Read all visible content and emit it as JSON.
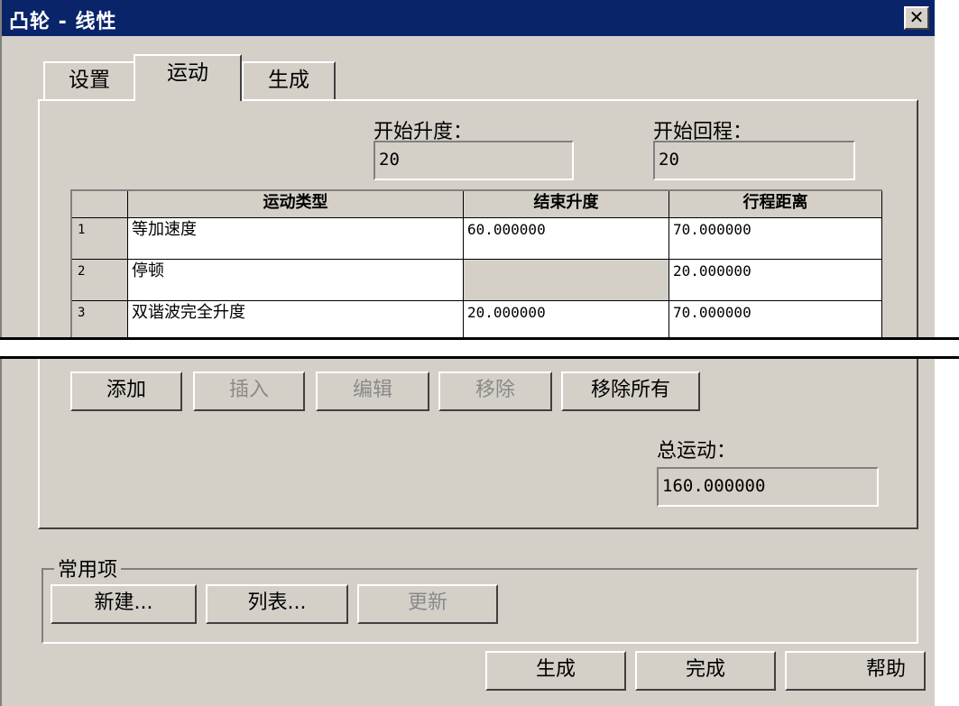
{
  "window": {
    "title": "凸轮 - 线性",
    "close_glyph": "✕"
  },
  "tabs": [
    {
      "label": "设置"
    },
    {
      "label": "运动"
    },
    {
      "label": "生成"
    }
  ],
  "motion": {
    "start_lift_label": "开始升度：",
    "start_lift_value": "20",
    "start_return_label": "开始回程：",
    "start_return_value": "20",
    "table": {
      "columns": [
        "运动类型",
        "结束升度",
        "行程距离"
      ],
      "rows": [
        {
          "num": "1",
          "type": "等加速度",
          "end_lift": "60.000000",
          "distance": "70.000000"
        },
        {
          "num": "2",
          "type": "停顿",
          "end_lift": "",
          "distance": "20.000000"
        },
        {
          "num": "3",
          "type": "双谐波完全升度",
          "end_lift": "20.000000",
          "distance": "70.000000"
        }
      ]
    },
    "buttons": {
      "add": "添加",
      "insert": "插入",
      "edit": "编辑",
      "remove": "移除",
      "remove_all": "移除所有"
    },
    "total_label": "总运动：",
    "total_value": "160.000000"
  },
  "common": {
    "group_label": "常用项",
    "new": "新建...",
    "list": "列表...",
    "update": "更新"
  },
  "footer": {
    "generate": "生成",
    "done": "完成",
    "help": "帮助"
  }
}
